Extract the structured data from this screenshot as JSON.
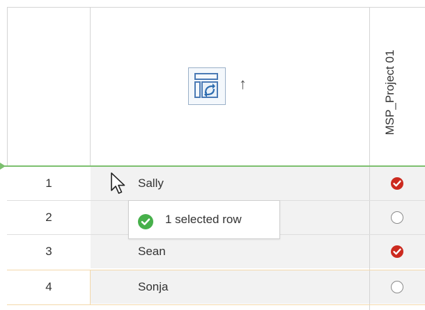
{
  "header": {
    "project_column_label": "MSP_Project 01",
    "sort_indicator": "↑",
    "sort_icon": "row-sort-icon"
  },
  "rows": [
    {
      "number": "1",
      "name": "Sally",
      "status": "checked"
    },
    {
      "number": "2",
      "name": "",
      "status": "empty"
    },
    {
      "number": "3",
      "name": "Sean",
      "status": "checked"
    },
    {
      "number": "4",
      "name": "Sonja",
      "status": "empty"
    }
  ],
  "tooltip": {
    "text": "1 selected row",
    "icon": "check-circle-icon"
  },
  "colors": {
    "accent_green": "#7cbf6e",
    "checked_red": "#cc2a1f",
    "ok_green": "#47b04b",
    "row_bg": "#f2f2f2",
    "focus_orange": "#f3d8a9"
  }
}
